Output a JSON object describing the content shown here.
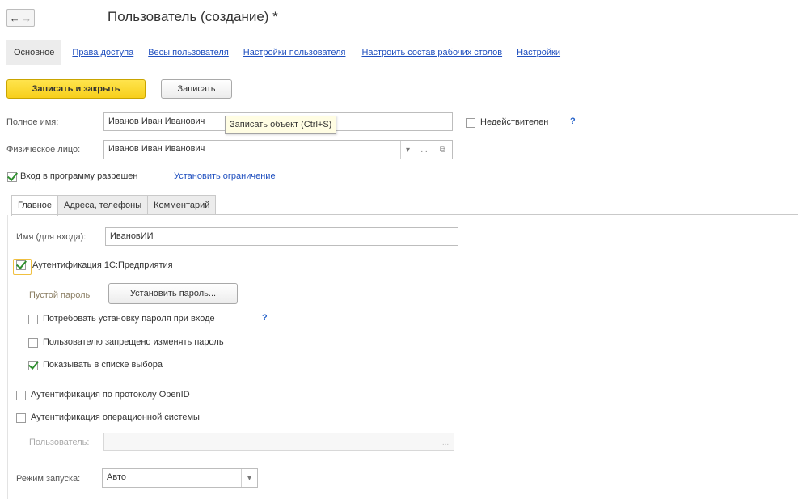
{
  "header": {
    "back_arrow": "←",
    "forward_arrow": "→",
    "title": "Пользователь (создание) *"
  },
  "nav": {
    "active_tab": "Основное",
    "links": [
      "Права доступа",
      "Весы пользователя",
      "Настройки пользователя",
      "Настроить состав рабочих столов",
      "Настройки"
    ]
  },
  "toolbar": {
    "save_close_label": "Записать и закрыть",
    "save_label": "Записать"
  },
  "tooltip": {
    "text": "Записать объект (Ctrl+S)"
  },
  "form": {
    "full_name_label": "Полное имя:",
    "full_name_value": "Иванов Иван Иванович",
    "invalid_label": "Недействителен",
    "help_mark": "?",
    "person_label": "Физическое лицо:",
    "person_value": "Иванов Иван Иванович",
    "person_dropdown": "▾",
    "person_choose": "...",
    "person_open": "⧉",
    "login_allowed_label": "Вход в программу разрешен",
    "set_restriction_link": "Установить ограничение"
  },
  "inner_tabs": [
    "Главное",
    "Адреса, телефоны",
    "Комментарий"
  ],
  "main": {
    "login_name_label": "Имя (для входа):",
    "login_name_value": "ИвановИИ",
    "auth_1c_label": "Аутентификация 1С:Предприятия",
    "empty_password_label": "Пустой пароль",
    "set_password_label": "Установить пароль...",
    "require_password_change_label": "Потребовать установку пароля при входе",
    "require_help": "?",
    "forbid_password_change_label": "Пользователю запрещено изменять пароль",
    "show_in_list_label": "Показывать в списке выбора",
    "openid_label": "Аутентификация по протоколу OpenID",
    "os_auth_label": "Аутентификация операционной системы",
    "os_user_label": "Пользователь:",
    "os_user_choose": "...",
    "launch_mode_label": "Режим запуска:",
    "launch_mode_value": "Авто",
    "launch_mode_dropdown": "▾"
  },
  "colors": {
    "primary_button": "#f7cf1b",
    "link": "#1f4fbf",
    "check": "#2f8f2f",
    "help": "#2260c9"
  }
}
